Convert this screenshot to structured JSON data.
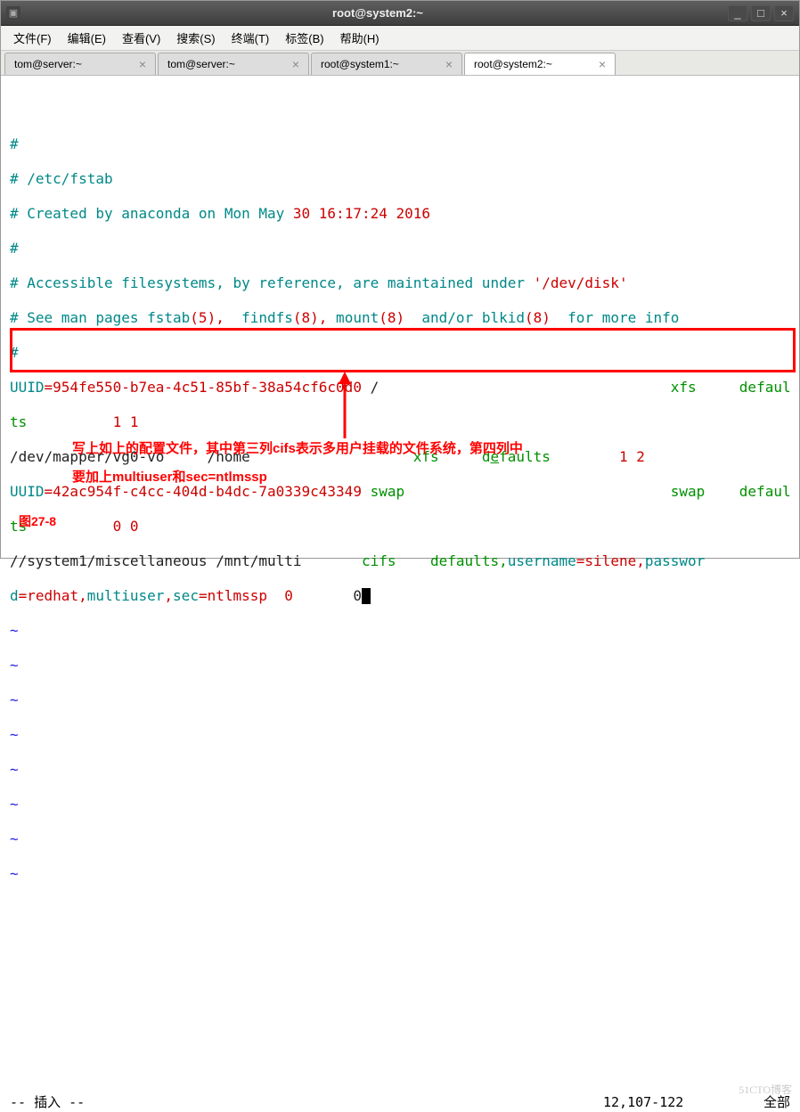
{
  "window": {
    "title": "root@system2:~",
    "min": "_",
    "max": "□",
    "close": "×"
  },
  "menu": {
    "file": "文件(F)",
    "edit": "编辑(E)",
    "view": "查看(V)",
    "search": "搜索(S)",
    "terminal": "终端(T)",
    "tabs": "标签(B)",
    "help": "帮助(H)"
  },
  "tabs": [
    {
      "label": "tom@server:~",
      "active": false
    },
    {
      "label": "tom@server:~",
      "active": false
    },
    {
      "label": "root@system1:~",
      "active": false
    },
    {
      "label": "root@system2:~",
      "active": true
    }
  ],
  "fstab": {
    "h1": "#",
    "h2": "# /etc/fstab",
    "h3a": "# Created by anaconda on Mon May ",
    "h3b": "30 16:17:24 2016",
    "h4": "#",
    "h5a": "# Accessible filesystems, by reference, are maintained under ",
    "h5b": "'/dev/disk'",
    "h6a": "# See man pages fstab",
    "h6b": "(5),",
    "h6c": "  findfs",
    "h6d": "(8),",
    "h6e": " mount",
    "h6f": "(8)",
    "h6g": "  and",
    "h6h": "/or blkid",
    "h6i": "(8)",
    "h6j": "  for more info",
    "h7": "#",
    "l1a": "UUID",
    "l1b": "=954fe550-b7ea-4c51-85bf-38a54cf6c0d0 ",
    "l1c": "/",
    "l1d": "                                  xfs     defaul",
    "l1e": "ts          ",
    "l1f": "1 1",
    "l2a": "/dev/mapper/vg0-vo     /home                   ",
    "l2b": "xfs     d",
    "l2c": "e",
    "l2d": "faults       ",
    "l2e": " 1 2",
    "l3a": "UUID",
    "l3b": "=42ac954f-c4cc-404d-b4dc-7a0339c43349 ",
    "l3c": "swap                               swap    defaul",
    "l3d": "ts          ",
    "l3e": "0 0",
    "l4a": "//system1/miscellaneous /mnt/multi       ",
    "l4b": "cifs    defaults,",
    "l4c": "username",
    "l4d": "=silene,",
    "l4e": "passwor",
    "l5a": "d",
    "l5b": "=redhat,",
    "l5c": "multiuser",
    "l5d": ",",
    "l5e": "sec",
    "l5f": "=ntlmssp  ",
    "l5g": "0",
    "l5h": "       0"
  },
  "tildes": [
    "~",
    "~",
    "~",
    "~",
    "~",
    "~",
    "~",
    "~"
  ],
  "figlabel": "图27-8",
  "annotation": {
    "line1": "写上如上的配置文件，其中第三列cifs表示多用户挂载的文件系统，第四列中",
    "line2": "要加上multiuser和sec=ntlmssp"
  },
  "statusbar": {
    "mode": "-- 插入 --",
    "pos": "12,107-122",
    "scroll": "全部"
  },
  "watermark": "51CTO博客"
}
